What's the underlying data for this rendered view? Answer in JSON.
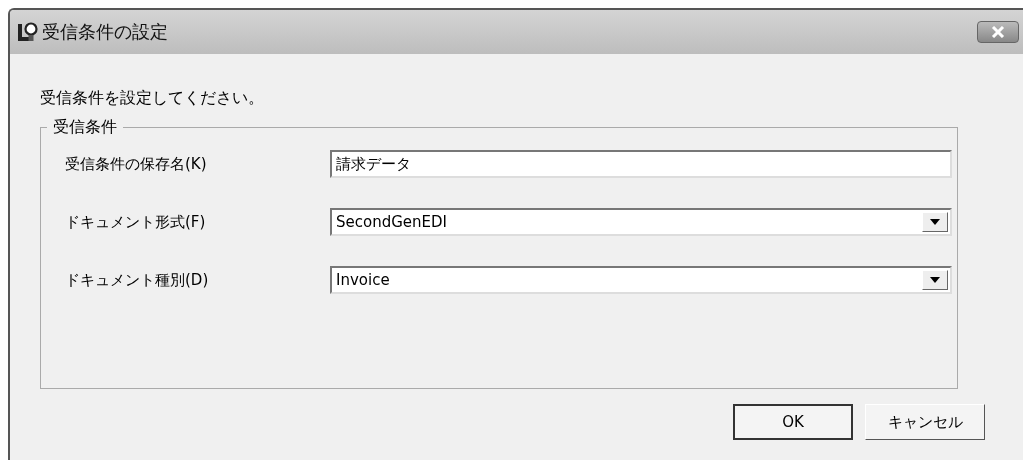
{
  "window": {
    "title": "受信条件の設定"
  },
  "instruction": "受信条件を設定してください。",
  "group": {
    "legend": "受信条件",
    "fields": [
      {
        "kind": "text",
        "label": "受信条件の保存名(K)",
        "value": "請求データ"
      },
      {
        "kind": "combo",
        "label": "ドキュメント形式(F)",
        "value": "SecondGenEDI"
      },
      {
        "kind": "combo",
        "label": "ドキュメント種別(D)",
        "value": "Invoice"
      }
    ]
  },
  "buttons": [
    "OK",
    "キャンセル"
  ]
}
